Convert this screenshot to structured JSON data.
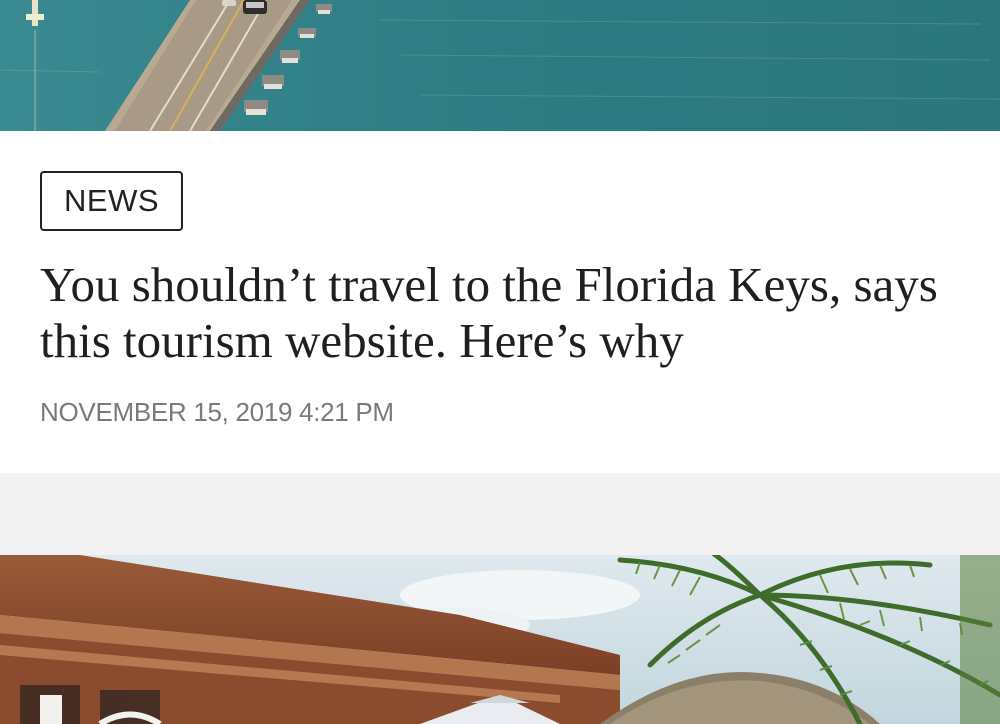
{
  "top_image": {
    "semantic": "bridge-over-water-photo"
  },
  "article": {
    "category": "NEWS",
    "headline": "You shouldn’t travel to the Florida Keys, says this tourism website. Here’s why",
    "timestamp": "NOVEMBER 15, 2019 4:21 PM"
  },
  "bottom_image": {
    "semantic": "resort-building-with-palm-photo"
  },
  "colors": {
    "text_primary": "#1f1f1f",
    "text_muted": "#7a7a7a",
    "card_background": "#ffffff",
    "page_background": "#f2f2f2"
  }
}
